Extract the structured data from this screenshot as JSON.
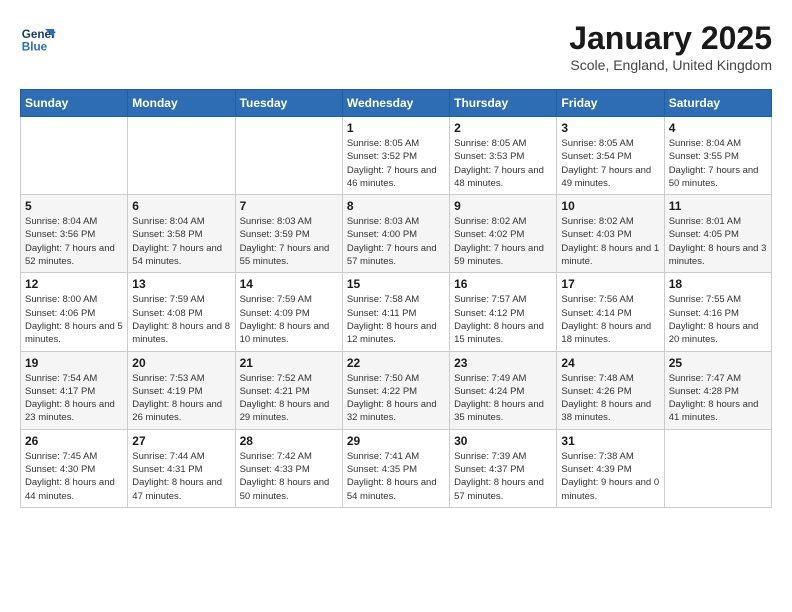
{
  "logo": {
    "text_general": "General",
    "text_blue": "Blue"
  },
  "header": {
    "month": "January 2025",
    "location": "Scole, England, United Kingdom"
  },
  "weekdays": [
    "Sunday",
    "Monday",
    "Tuesday",
    "Wednesday",
    "Thursday",
    "Friday",
    "Saturday"
  ],
  "weeks": [
    [
      {
        "day": "",
        "info": ""
      },
      {
        "day": "",
        "info": ""
      },
      {
        "day": "",
        "info": ""
      },
      {
        "day": "1",
        "info": "Sunrise: 8:05 AM\nSunset: 3:52 PM\nDaylight: 7 hours and 46 minutes."
      },
      {
        "day": "2",
        "info": "Sunrise: 8:05 AM\nSunset: 3:53 PM\nDaylight: 7 hours and 48 minutes."
      },
      {
        "day": "3",
        "info": "Sunrise: 8:05 AM\nSunset: 3:54 PM\nDaylight: 7 hours and 49 minutes."
      },
      {
        "day": "4",
        "info": "Sunrise: 8:04 AM\nSunset: 3:55 PM\nDaylight: 7 hours and 50 minutes."
      }
    ],
    [
      {
        "day": "5",
        "info": "Sunrise: 8:04 AM\nSunset: 3:56 PM\nDaylight: 7 hours and 52 minutes."
      },
      {
        "day": "6",
        "info": "Sunrise: 8:04 AM\nSunset: 3:58 PM\nDaylight: 7 hours and 54 minutes."
      },
      {
        "day": "7",
        "info": "Sunrise: 8:03 AM\nSunset: 3:59 PM\nDaylight: 7 hours and 55 minutes."
      },
      {
        "day": "8",
        "info": "Sunrise: 8:03 AM\nSunset: 4:00 PM\nDaylight: 7 hours and 57 minutes."
      },
      {
        "day": "9",
        "info": "Sunrise: 8:02 AM\nSunset: 4:02 PM\nDaylight: 7 hours and 59 minutes."
      },
      {
        "day": "10",
        "info": "Sunrise: 8:02 AM\nSunset: 4:03 PM\nDaylight: 8 hours and 1 minute."
      },
      {
        "day": "11",
        "info": "Sunrise: 8:01 AM\nSunset: 4:05 PM\nDaylight: 8 hours and 3 minutes."
      }
    ],
    [
      {
        "day": "12",
        "info": "Sunrise: 8:00 AM\nSunset: 4:06 PM\nDaylight: 8 hours and 5 minutes."
      },
      {
        "day": "13",
        "info": "Sunrise: 7:59 AM\nSunset: 4:08 PM\nDaylight: 8 hours and 8 minutes."
      },
      {
        "day": "14",
        "info": "Sunrise: 7:59 AM\nSunset: 4:09 PM\nDaylight: 8 hours and 10 minutes."
      },
      {
        "day": "15",
        "info": "Sunrise: 7:58 AM\nSunset: 4:11 PM\nDaylight: 8 hours and 12 minutes."
      },
      {
        "day": "16",
        "info": "Sunrise: 7:57 AM\nSunset: 4:12 PM\nDaylight: 8 hours and 15 minutes."
      },
      {
        "day": "17",
        "info": "Sunrise: 7:56 AM\nSunset: 4:14 PM\nDaylight: 8 hours and 18 minutes."
      },
      {
        "day": "18",
        "info": "Sunrise: 7:55 AM\nSunset: 4:16 PM\nDaylight: 8 hours and 20 minutes."
      }
    ],
    [
      {
        "day": "19",
        "info": "Sunrise: 7:54 AM\nSunset: 4:17 PM\nDaylight: 8 hours and 23 minutes."
      },
      {
        "day": "20",
        "info": "Sunrise: 7:53 AM\nSunset: 4:19 PM\nDaylight: 8 hours and 26 minutes."
      },
      {
        "day": "21",
        "info": "Sunrise: 7:52 AM\nSunset: 4:21 PM\nDaylight: 8 hours and 29 minutes."
      },
      {
        "day": "22",
        "info": "Sunrise: 7:50 AM\nSunset: 4:22 PM\nDaylight: 8 hours and 32 minutes."
      },
      {
        "day": "23",
        "info": "Sunrise: 7:49 AM\nSunset: 4:24 PM\nDaylight: 8 hours and 35 minutes."
      },
      {
        "day": "24",
        "info": "Sunrise: 7:48 AM\nSunset: 4:26 PM\nDaylight: 8 hours and 38 minutes."
      },
      {
        "day": "25",
        "info": "Sunrise: 7:47 AM\nSunset: 4:28 PM\nDaylight: 8 hours and 41 minutes."
      }
    ],
    [
      {
        "day": "26",
        "info": "Sunrise: 7:45 AM\nSunset: 4:30 PM\nDaylight: 8 hours and 44 minutes."
      },
      {
        "day": "27",
        "info": "Sunrise: 7:44 AM\nSunset: 4:31 PM\nDaylight: 8 hours and 47 minutes."
      },
      {
        "day": "28",
        "info": "Sunrise: 7:42 AM\nSunset: 4:33 PM\nDaylight: 8 hours and 50 minutes."
      },
      {
        "day": "29",
        "info": "Sunrise: 7:41 AM\nSunset: 4:35 PM\nDaylight: 8 hours and 54 minutes."
      },
      {
        "day": "30",
        "info": "Sunrise: 7:39 AM\nSunset: 4:37 PM\nDaylight: 8 hours and 57 minutes."
      },
      {
        "day": "31",
        "info": "Sunrise: 7:38 AM\nSunset: 4:39 PM\nDaylight: 9 hours and 0 minutes."
      },
      {
        "day": "",
        "info": ""
      }
    ]
  ]
}
